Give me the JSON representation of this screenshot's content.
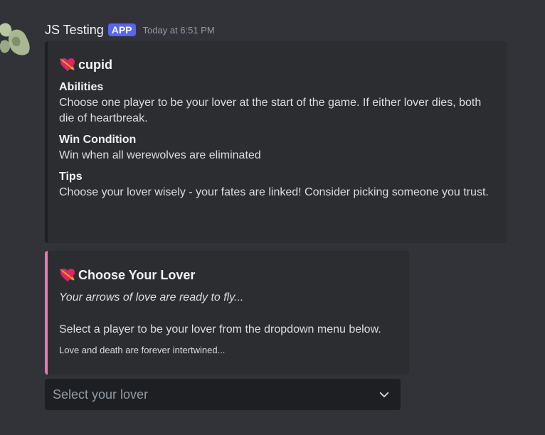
{
  "message": {
    "username": "JS Testing",
    "badge": "APP",
    "timestamp": "Today at 6:51 PM"
  },
  "embeds": [
    {
      "icon": "heart-with-arrow-icon",
      "title": "cupid",
      "accent_color": "#1e1f22",
      "fields": [
        {
          "name": "Abilities",
          "value": "Choose one player to be your lover at the start of the game. If either lover dies, both die of heartbreak."
        },
        {
          "name": "Win Condition",
          "value": "Win when all werewolves are eliminated"
        },
        {
          "name": "Tips",
          "value": "Choose your lover wisely - your fates are linked! Consider picking someone you trust."
        }
      ]
    },
    {
      "icon": "heart-with-arrow-icon",
      "title": "Choose Your Lover",
      "accent_color": "#f472b6",
      "description_italic": "Your arrows of love are ready to fly...",
      "description": "Select a player to be your lover from the dropdown menu below.",
      "footer": "Love and death are forever intertwined..."
    }
  ],
  "select": {
    "placeholder": "Select your lover",
    "icon": "chevron-down-icon"
  },
  "colors": {
    "background": "#323339",
    "embed_background": "#2b2d31",
    "badge": "#5865f2",
    "select_background": "#1e1f22"
  }
}
